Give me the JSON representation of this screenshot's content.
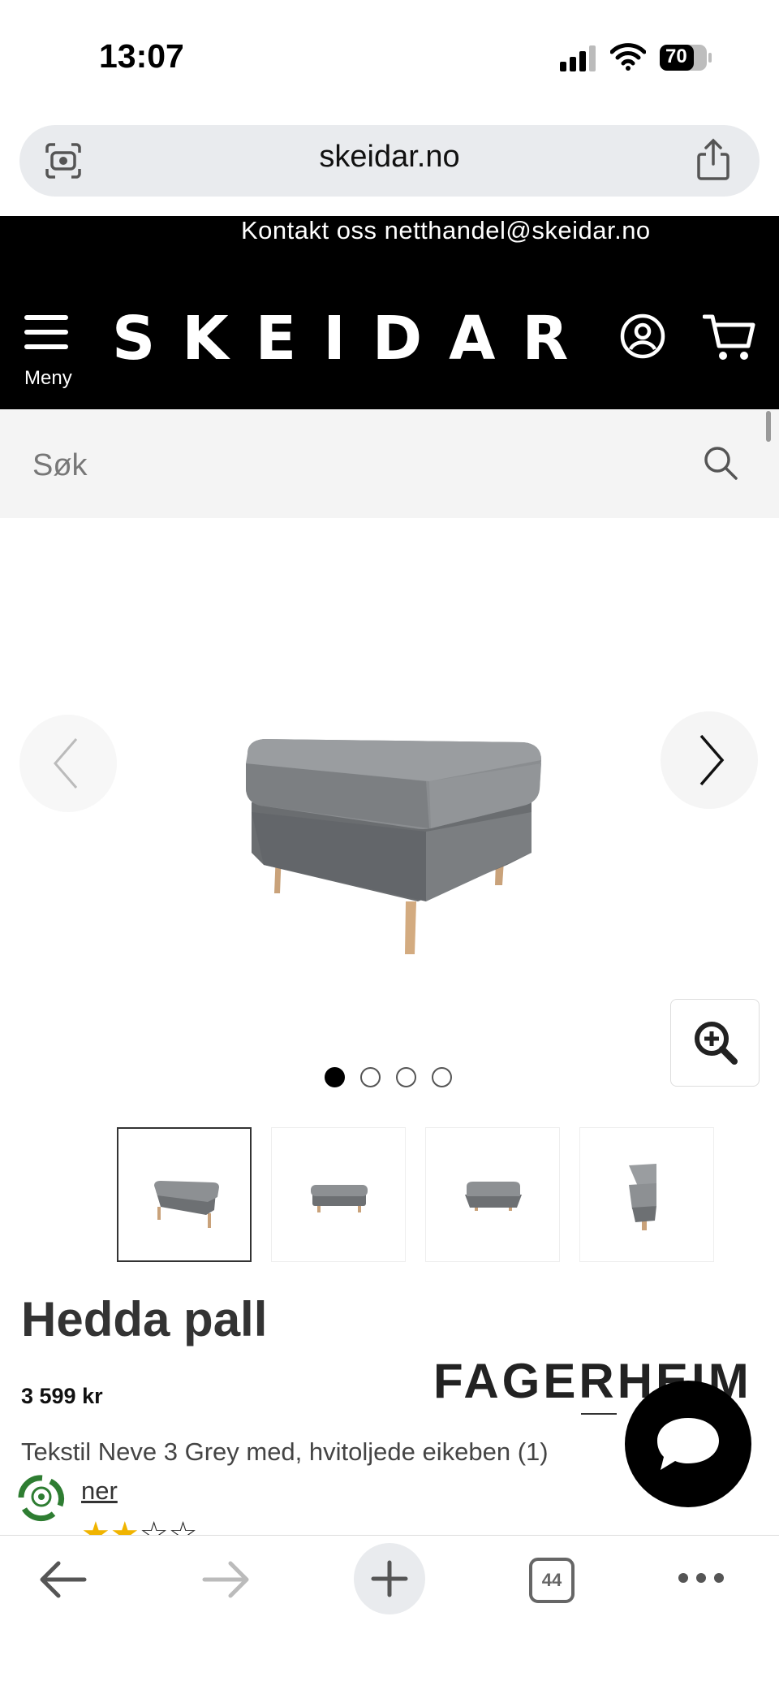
{
  "status": {
    "time": "13:07",
    "battery": "70"
  },
  "browser": {
    "url": "skeidar.no",
    "tab_count": "44"
  },
  "header": {
    "contact": "Kontakt oss netthandel@skeidar.no",
    "logo": "SKEIDAR",
    "menu_label": "Meny"
  },
  "search": {
    "placeholder": "Søk"
  },
  "carousel": {
    "active_index": 0,
    "slide_count": 4
  },
  "product": {
    "title": "Hedda pall",
    "price": "3 599 kr",
    "brand": "FAGERHEIM",
    "variant": "Tekstil Neve 3 Grey med, hvitoljede eikeben (1)",
    "options_link": "ner",
    "rating": {
      "filled": 2,
      "total": 4
    }
  },
  "colors": {
    "header_bg": "#000000",
    "accent_star": "#f0b400",
    "search_bg": "#f4f4f4"
  }
}
